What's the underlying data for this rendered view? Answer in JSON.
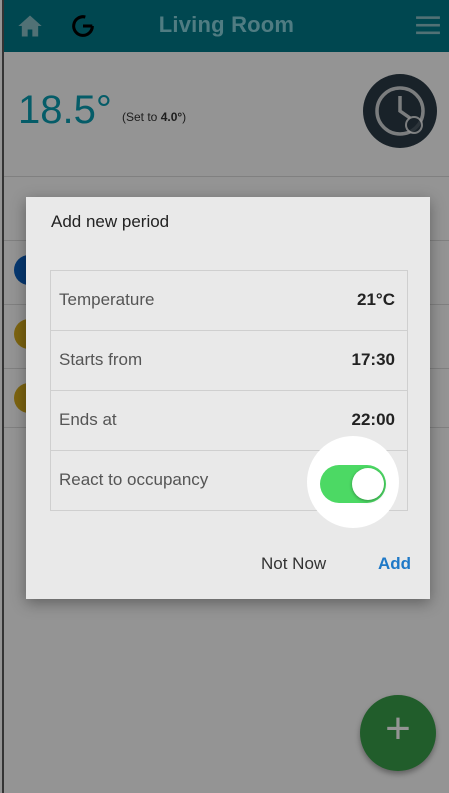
{
  "appbar": {
    "title": "Living Room",
    "icons": [
      "home-icon",
      "cycle-icon",
      "menu-icon"
    ],
    "background": "#007a8a"
  },
  "main": {
    "current_temperature": "18.5°",
    "setpoint_prefix": "(Set to ",
    "setpoint_value": "4.0°",
    "setpoint_suffix": ")",
    "clock_icon": "clock-icon",
    "list_dots": [
      "#0a5fc2",
      "#d7ad1d",
      "#d7ad1d"
    ]
  },
  "dialog": {
    "title": "Add new period",
    "rows": [
      {
        "label": "Temperature",
        "value": "21°C"
      },
      {
        "label": "Starts from",
        "value": "17:30"
      },
      {
        "label": "Ends at",
        "value": "22:00"
      },
      {
        "label": "React to occupancy",
        "value": ""
      }
    ],
    "react_to_occupancy_enabled": true,
    "actions": {
      "not_now": "Not Now",
      "add": "Add"
    }
  },
  "fab": {
    "label": "+",
    "color": "#3aa04a"
  },
  "colors": {
    "accent": "#1f79c7",
    "toggle_on": "#4cd964",
    "temp": "#0a9fb3"
  }
}
